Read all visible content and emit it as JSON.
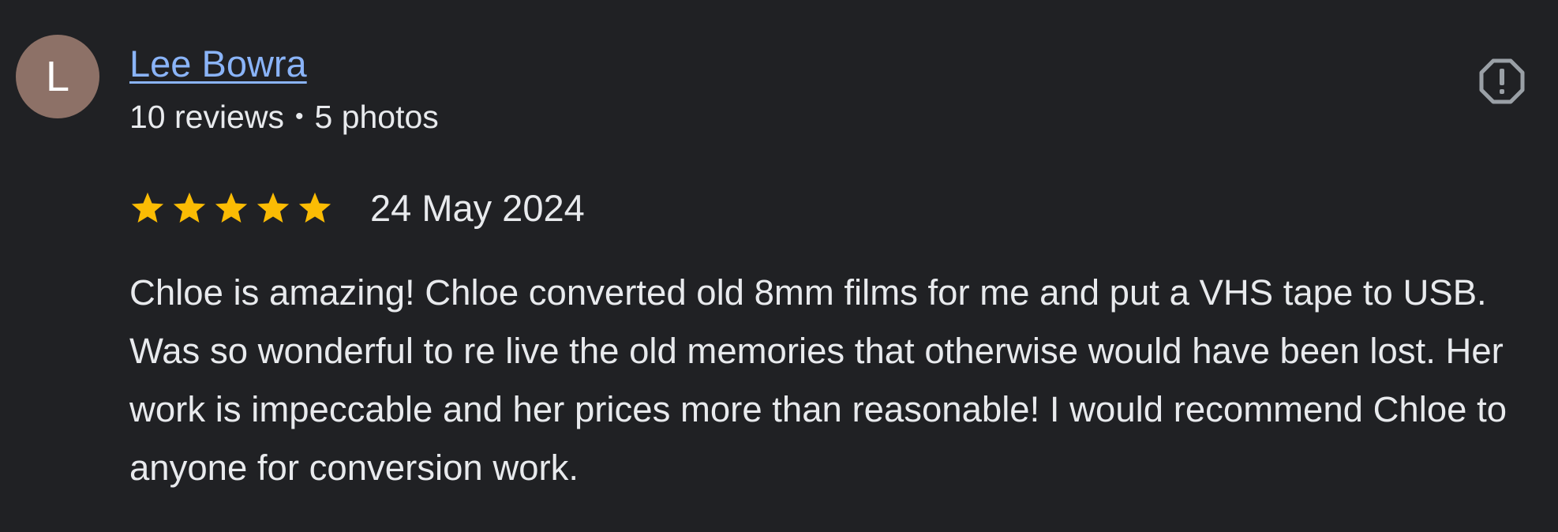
{
  "reviewer": {
    "avatar_letter": "L",
    "avatar_color": "#8d7167",
    "name": "Lee Bowra",
    "reviews_count": "10 reviews",
    "separator": "•",
    "photos_count": "5 photos"
  },
  "report": {
    "icon": "report-flag-icon"
  },
  "review": {
    "rating": 5,
    "rating_max": 5,
    "star_color": "#fbbc04",
    "date": "24 May 2024",
    "text": "Chloe is amazing! Chloe converted old 8mm films for me and put a VHS tape to USB. Was so wonderful to re live the old memories that otherwise would have been lost. Her work is impeccable and her prices more than reasonable! I would recommend Chloe to anyone for conversion work."
  },
  "colors": {
    "background": "#202124",
    "link": "#8ab4f8",
    "text": "#e8eaed",
    "icon": "#9aa0a6"
  }
}
